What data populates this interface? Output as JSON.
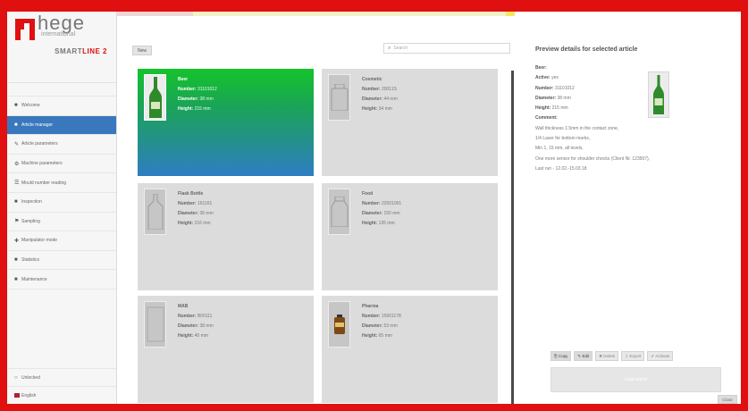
{
  "brand": {
    "word": "hege",
    "sub": "international",
    "product_a": "SMART",
    "product_b": "LINE 2"
  },
  "sidebar": {
    "items": [
      {
        "icon": "home-icon",
        "glyph": "■",
        "label": "Welcome"
      },
      {
        "icon": "article-icon",
        "glyph": "■",
        "label": "Article manager"
      },
      {
        "icon": "wrench-icon",
        "glyph": "✎",
        "label": "Article parameters"
      },
      {
        "icon": "gear-icon",
        "glyph": "⚙",
        "label": "Machine parameters"
      },
      {
        "icon": "list-icon",
        "glyph": "☰",
        "label": "Mould number reading"
      },
      {
        "icon": "inspection-icon",
        "glyph": "■",
        "label": "Inspection"
      },
      {
        "icon": "sampling-icon",
        "glyph": "⚑",
        "label": "Sampling"
      },
      {
        "icon": "plot-icon",
        "glyph": "✚",
        "label": "Manipulator mode"
      },
      {
        "icon": "stats-icon",
        "glyph": "■",
        "label": "Statistics"
      },
      {
        "icon": "maintenance-icon",
        "glyph": "■",
        "label": "Maintenance"
      }
    ],
    "active_index": 1,
    "bottom": [
      {
        "label": "Unlocked",
        "icon": "lock-icon",
        "glyph": "○"
      },
      {
        "label": "English",
        "icon": "flag-icon",
        "glyph": ""
      }
    ]
  },
  "toolbar": {
    "new_label": "New",
    "search_placeholder": "Search"
  },
  "articles": [
    {
      "name": "Beer",
      "number_label": "Number:",
      "number": "31101012",
      "diameter_label": "Diameter:",
      "diameter": "38 mm",
      "height_label": "Height:",
      "height": "215 mm",
      "selected": true,
      "shape": "longneck",
      "color": "#2f8a2a"
    },
    {
      "name": "Cosmetic",
      "number_label": "Number:",
      "number": "20011S",
      "diameter_label": "Diameter:",
      "diameter": "44 mm",
      "height_label": "Height:",
      "height": "34 mm",
      "selected": false,
      "shape": "jar",
      "color": "#bdbdbd"
    },
    {
      "name": "Flask Bottle",
      "number_label": "Number:",
      "number": "161161",
      "diameter_label": "Diameter:",
      "diameter": "36 mm",
      "height_label": "Height:",
      "height": "216 mm",
      "selected": false,
      "shape": "flask",
      "color": "#bdbdbd"
    },
    {
      "name": "Food",
      "number_label": "Number:",
      "number": "22001001",
      "diameter_label": "Diameter:",
      "diameter": "150 mm",
      "height_label": "Height:",
      "height": "135 mm",
      "selected": false,
      "shape": "food",
      "color": "#bdbdbd"
    },
    {
      "name": "MAB",
      "number_label": "Number:",
      "number": "B00111",
      "diameter_label": "Diameter:",
      "diameter": "38 mm",
      "height_label": "Height:",
      "height": "40 mm",
      "selected": false,
      "shape": "box",
      "color": "#bdbdbd"
    },
    {
      "name": "Pharma",
      "number_label": "Number:",
      "number": "15001178",
      "diameter_label": "Diameter:",
      "diameter": "53 mm",
      "height_label": "Height:",
      "height": "65 mm",
      "selected": false,
      "shape": "vial",
      "color": "#7a4a14"
    }
  ],
  "preview": {
    "title": "Preview details for selected article",
    "name": "Beer",
    "active_label": "Active:",
    "active": "yes",
    "number_label": "Number:",
    "number": "31101012",
    "diameter_label": "Diameter:",
    "diameter": "38 mm",
    "height_label": "Height:",
    "height": "215 mm",
    "comment_label": "Comment:",
    "comment_lines": [
      "Wall thickness 1.5mm in the contact zone,",
      "1/4 Laser for bottom marks,",
      "Min 1, 15 mm, all levels,",
      "One more sensor for shoulder checks (Client Nr. 123507),",
      "Last run - 12.02.-15.03.18"
    ],
    "actions": [
      {
        "label": "Copy",
        "glyph": "⎘",
        "icon": "copy-icon",
        "enabled": true
      },
      {
        "label": "Edit",
        "glyph": "✎",
        "icon": "edit-icon",
        "enabled": true
      },
      {
        "label": "Delete",
        "glyph": "✖",
        "icon": "delete-icon",
        "enabled": false
      },
      {
        "label": "Export",
        "glyph": "⇩",
        "icon": "export-icon",
        "enabled": false
      },
      {
        "label": "Activate",
        "glyph": "✔",
        "icon": "activate-icon",
        "enabled": false
      }
    ],
    "load_label": "Load article",
    "close_label": "Close"
  }
}
